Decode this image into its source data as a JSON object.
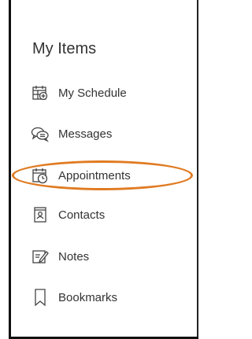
{
  "sidebar": {
    "title": "My Items",
    "items": [
      {
        "label": "My Schedule",
        "icon": "calendar-add-icon"
      },
      {
        "label": "Messages",
        "icon": "chat-bubbles-icon"
      },
      {
        "label": "Appointments",
        "icon": "calendar-clock-icon",
        "highlighted": true
      },
      {
        "label": "Contacts",
        "icon": "contact-card-icon"
      },
      {
        "label": "Notes",
        "icon": "note-edit-icon"
      },
      {
        "label": "Bookmarks",
        "icon": "bookmark-icon"
      }
    ]
  },
  "colors": {
    "highlight_ring": "#e07b22",
    "text": "#333333"
  }
}
